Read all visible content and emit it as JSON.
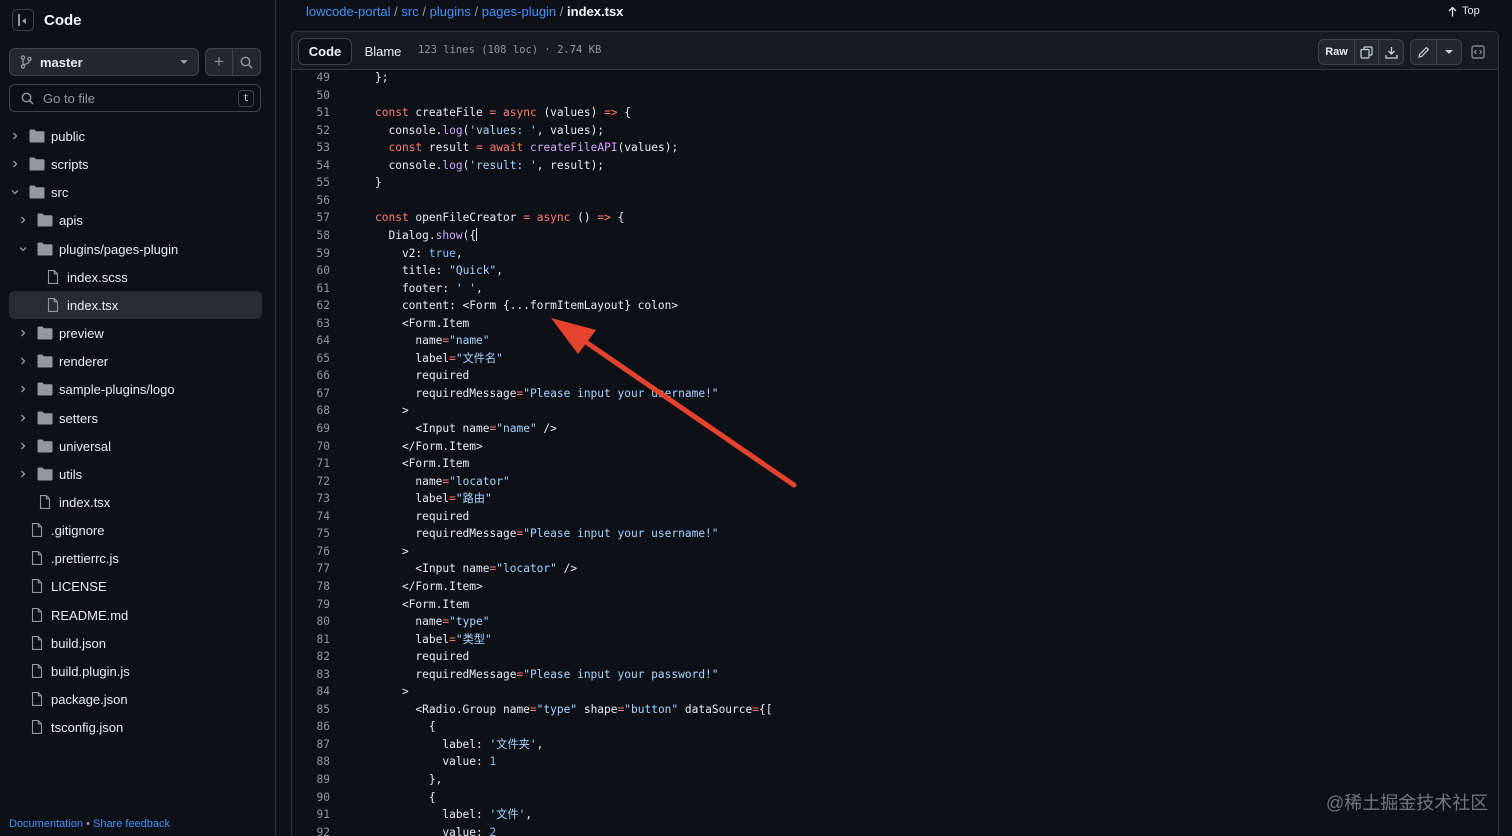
{
  "sidebar": {
    "title": "Code",
    "branch": "master",
    "goto_placeholder": "Go to file",
    "goto_shortcut": "t",
    "tree": [
      {
        "label": "public",
        "kind": "folder",
        "depth": 0,
        "expanded": false,
        "selected": false
      },
      {
        "label": "scripts",
        "kind": "folder",
        "depth": 0,
        "expanded": false,
        "selected": false
      },
      {
        "label": "src",
        "kind": "folder",
        "depth": 0,
        "expanded": true,
        "selected": false
      },
      {
        "label": "apis",
        "kind": "folder",
        "depth": 1,
        "expanded": false,
        "selected": false
      },
      {
        "label": "plugins/pages-plugin",
        "kind": "folder",
        "depth": 1,
        "expanded": true,
        "selected": false
      },
      {
        "label": "index.scss",
        "kind": "file",
        "depth": 2,
        "expanded": false,
        "selected": false
      },
      {
        "label": "index.tsx",
        "kind": "file",
        "depth": 2,
        "expanded": false,
        "selected": true
      },
      {
        "label": "preview",
        "kind": "folder",
        "depth": 1,
        "expanded": false,
        "selected": false
      },
      {
        "label": "renderer",
        "kind": "folder",
        "depth": 1,
        "expanded": false,
        "selected": false
      },
      {
        "label": "sample-plugins/logo",
        "kind": "folder",
        "depth": 1,
        "expanded": false,
        "selected": false
      },
      {
        "label": "setters",
        "kind": "folder",
        "depth": 1,
        "expanded": false,
        "selected": false
      },
      {
        "label": "universal",
        "kind": "folder",
        "depth": 1,
        "expanded": false,
        "selected": false
      },
      {
        "label": "utils",
        "kind": "folder",
        "depth": 1,
        "expanded": false,
        "selected": false
      },
      {
        "label": "index.tsx",
        "kind": "file",
        "depth": 1,
        "expanded": false,
        "selected": false
      },
      {
        "label": ".gitignore",
        "kind": "file",
        "depth": 0,
        "expanded": false,
        "selected": false
      },
      {
        "label": ".prettierrc.js",
        "kind": "file",
        "depth": 0,
        "expanded": false,
        "selected": false
      },
      {
        "label": "LICENSE",
        "kind": "file",
        "depth": 0,
        "expanded": false,
        "selected": false
      },
      {
        "label": "README.md",
        "kind": "file",
        "depth": 0,
        "expanded": false,
        "selected": false
      },
      {
        "label": "build.json",
        "kind": "file",
        "depth": 0,
        "expanded": false,
        "selected": false
      },
      {
        "label": "build.plugin.js",
        "kind": "file",
        "depth": 0,
        "expanded": false,
        "selected": false
      },
      {
        "label": "package.json",
        "kind": "file",
        "depth": 0,
        "expanded": false,
        "selected": false
      },
      {
        "label": "tsconfig.json",
        "kind": "file",
        "depth": 0,
        "expanded": false,
        "selected": false
      }
    ],
    "footer": {
      "documentation": "Documentation",
      "separator": "•",
      "feedback": "Share feedback"
    }
  },
  "breadcrumb": {
    "parts": [
      "lowcode-portal",
      "src",
      "plugins",
      "pages-plugin"
    ],
    "separator": "/",
    "current": "index.tsx"
  },
  "top_link": "Top",
  "file": {
    "tabs": [
      "Code",
      "Blame"
    ],
    "active_tab": "Code",
    "meta": "123 lines (108 loc) · 2.74 KB",
    "raw_label": "Raw"
  },
  "code_lines": [
    {
      "n": "49",
      "text": "};"
    },
    {
      "n": "50",
      "text": ""
    },
    {
      "n": "51",
      "text": "const createFile = async (values) => {"
    },
    {
      "n": "52",
      "text": "  console.log('values: ', values);"
    },
    {
      "n": "53",
      "text": "  const result = await createFileAPI(values);"
    },
    {
      "n": "54",
      "text": "  console.log('result: ', result);"
    },
    {
      "n": "55",
      "text": "}"
    },
    {
      "n": "56",
      "text": ""
    },
    {
      "n": "57",
      "text": "const openFileCreator = async () => {"
    },
    {
      "n": "58",
      "text": "  Dialog.show({"
    },
    {
      "n": "59",
      "text": "    v2: true,"
    },
    {
      "n": "60",
      "text": "    title: \"Quick\","
    },
    {
      "n": "61",
      "text": "    footer: ' ',"
    },
    {
      "n": "62",
      "text": "    content: <Form {...formItemLayout} colon>"
    },
    {
      "n": "63",
      "text": "    <Form.Item"
    },
    {
      "n": "64",
      "text": "      name=\"name\""
    },
    {
      "n": "65",
      "text": "      label=\"文件名\""
    },
    {
      "n": "66",
      "text": "      required"
    },
    {
      "n": "67",
      "text": "      requiredMessage=\"Please input your username!\""
    },
    {
      "n": "68",
      "text": "    >"
    },
    {
      "n": "69",
      "text": "      <Input name=\"name\" />"
    },
    {
      "n": "70",
      "text": "    </Form.Item>"
    },
    {
      "n": "71",
      "text": "    <Form.Item"
    },
    {
      "n": "72",
      "text": "      name=\"locator\""
    },
    {
      "n": "73",
      "text": "      label=\"路由\""
    },
    {
      "n": "74",
      "text": "      required"
    },
    {
      "n": "75",
      "text": "      requiredMessage=\"Please input your username!\""
    },
    {
      "n": "76",
      "text": "    >"
    },
    {
      "n": "77",
      "text": "      <Input name=\"locator\" />"
    },
    {
      "n": "78",
      "text": "    </Form.Item>"
    },
    {
      "n": "79",
      "text": "    <Form.Item"
    },
    {
      "n": "80",
      "text": "      name=\"type\""
    },
    {
      "n": "81",
      "text": "      label=\"类型\""
    },
    {
      "n": "82",
      "text": "      required"
    },
    {
      "n": "83",
      "text": "      requiredMessage=\"Please input your password!\""
    },
    {
      "n": "84",
      "text": "    >"
    },
    {
      "n": "85",
      "text": "      <Radio.Group name=\"type\" shape=\"button\" dataSource={["
    },
    {
      "n": "86",
      "text": "        {"
    },
    {
      "n": "87",
      "text": "          label: '文件夹',"
    },
    {
      "n": "88",
      "text": "          value: 1"
    },
    {
      "n": "89",
      "text": "        },"
    },
    {
      "n": "90",
      "text": "        {"
    },
    {
      "n": "91",
      "text": "          label: '文件',"
    },
    {
      "n": "92",
      "text": "          value: 2"
    }
  ],
  "watermark": "@稀土掘金技术社区",
  "colors": {
    "background": "#0d1117",
    "link": "#4493f8",
    "keyword": "#ff7b72",
    "function": "#d2a8ff",
    "string": "#a5d6ff",
    "constant": "#79c0ff",
    "tag": "#7ee787",
    "annotation_arrow": "#e5432d"
  }
}
